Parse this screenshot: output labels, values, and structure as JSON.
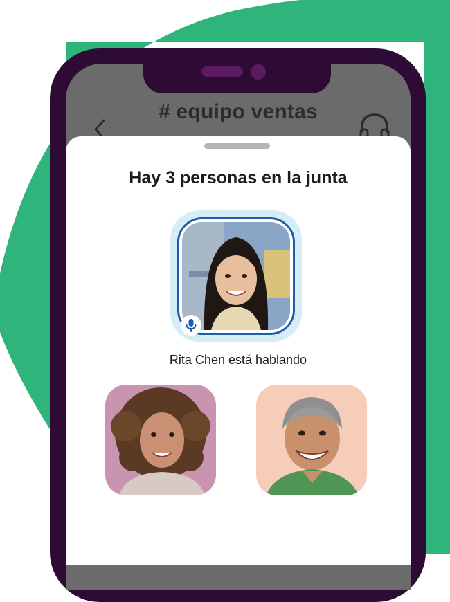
{
  "header": {
    "channel_title": "# equipo ventas"
  },
  "huddle_sheet": {
    "title": "Hay 3 personas en la junta",
    "active_speaker": {
      "status_text": "Rita Chen está hablando",
      "mic_icon": "microphone-icon"
    },
    "participants": [
      {
        "avatar": "avatar-speaker"
      },
      {
        "avatar": "avatar-participant-curly-hair"
      },
      {
        "avatar": "avatar-participant-smiling-man"
      }
    ]
  },
  "colors": {
    "brand_green": "#2fb47c",
    "phone_frame": "#2e0b34",
    "speaking_ring": "#1f5ea8",
    "speaking_glow": "#d6ecf7"
  },
  "icons": {
    "back": "chevron-left-icon",
    "huddle": "headphones-icon"
  }
}
